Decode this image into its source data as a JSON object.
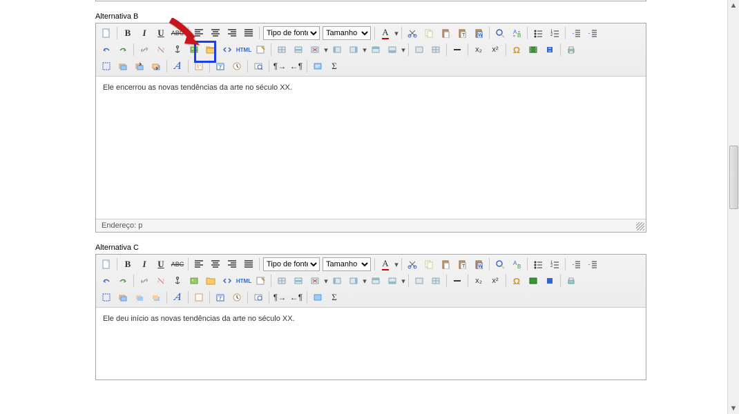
{
  "sections": {
    "b": {
      "label": "Alternativa B",
      "content": "Ele encerrou as novas tendências da arte no século XX.",
      "path": "Endereço: p",
      "font_family_label": "Tipo de fonte",
      "font_size_label": "Tamanho"
    },
    "c": {
      "label": "Alternativa C",
      "content": "Ele deu início as novas tendências da arte no século XX.",
      "font_family_label": "Tipo de fonte",
      "font_size_label": "Tamanho"
    }
  },
  "icons": {
    "newdoc": "newdoc",
    "bold": "B",
    "italic": "I",
    "underline": "U",
    "strike": "ABC",
    "align_left": "left",
    "align_center": "center",
    "align_right": "right",
    "align_justify": "justify",
    "text_color": "A",
    "cut": "cut",
    "copy": "copy",
    "paste": "paste",
    "paste_text": "pastetext",
    "paste_word": "pasteword",
    "find": "find",
    "replace": "replace",
    "list_bullet": "ul",
    "list_number": "ol",
    "outdent": "outdent",
    "indent": "indent",
    "undo": "undo",
    "redo": "redo",
    "link": "link",
    "unlink": "unlink",
    "anchor": "anchor",
    "image": "image",
    "file_browser": "folder",
    "code": "code",
    "html": "HTML",
    "cleanup": "cleanup",
    "table": "table",
    "table_row": "row",
    "table_split": "split",
    "table_merge": "merge",
    "table_delete": "tdel",
    "table_props": "tprops",
    "table_cell": "tcell",
    "hr": "hr",
    "sub": "x₂",
    "sup": "x²",
    "omega": "Ω",
    "media": "media",
    "flash": "flash",
    "print": "print",
    "fullscreen": "fullscreen",
    "layers": "layers",
    "layer_fwd": "lfwd",
    "layer_back": "lback",
    "styles": "𝐴",
    "template": "template",
    "date": "date",
    "time": "time",
    "preview": "preview",
    "ltr": "ltr",
    "rtl": "rtl",
    "cite": "cite",
    "sigma": "Σ"
  },
  "colors": {
    "toolbar_bg": "#f0f0f0",
    "border": "#a7a7a7",
    "highlight": "#1a3ee8",
    "arrow": "#c8171c"
  }
}
